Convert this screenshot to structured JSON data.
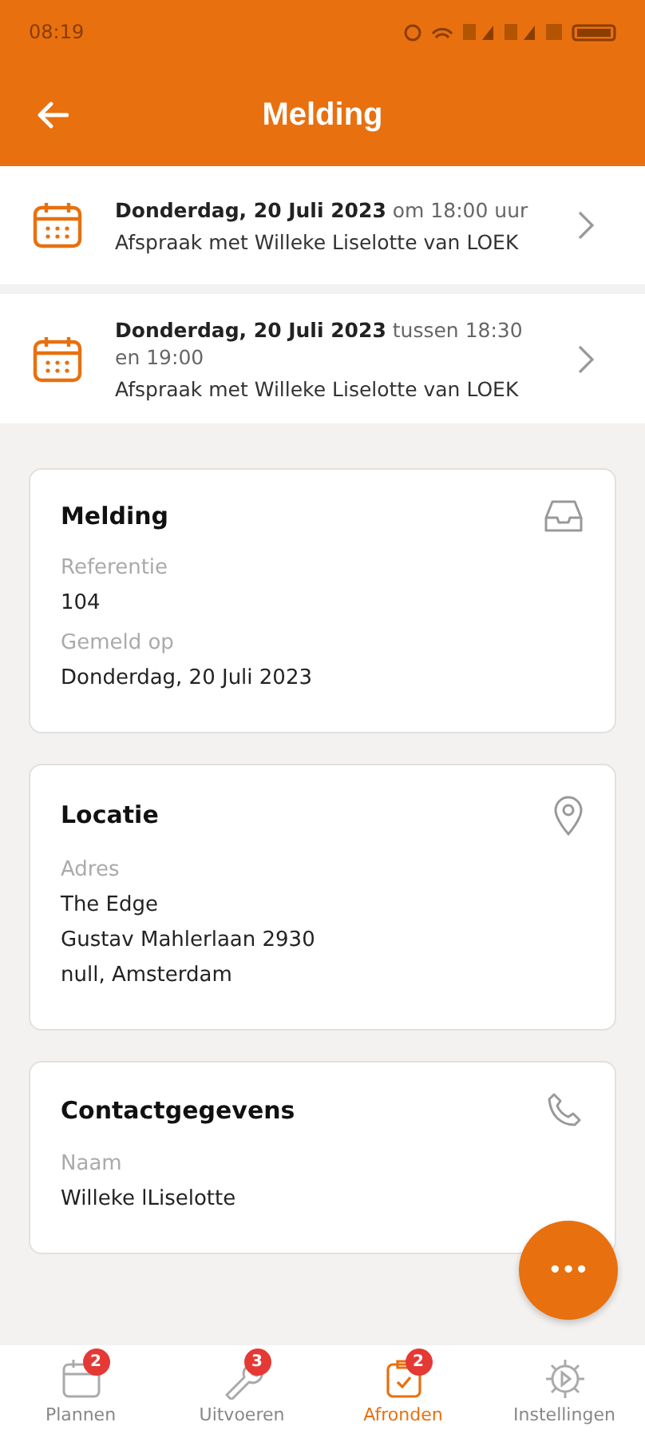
{
  "status_bar": {
    "time": "08:19"
  },
  "header": {
    "title": "Melding"
  },
  "appointments": [
    {
      "when": "**Donderdag, 20 Juli 2023** om 18:00 uur",
      "subject": "Afspraak met Willeke Liselotte van LOEK"
    },
    {
      "when": "**Donderdag, 20 Juli 2023** tussen 18:30 en 19:00",
      "subject": "Afspraak met Willeke Liselotte van LOEK"
    }
  ],
  "cards": [
    {
      "title": "Melding",
      "kind": "inbox",
      "fields": [
        {
          "label": "Referentie",
          "lines": [
            "104"
          ]
        },
        {
          "label": "Gemeld op",
          "lines": [
            "Donderdag, 20 Juli 2023"
          ]
        }
      ]
    },
    {
      "title": "Locatie",
      "kind": "pin",
      "fields": [
        {
          "label": "Adres",
          "lines": [
            "The Edge",
            "Gustav Mahlerlaan 2930",
            "null, Amsterdam"
          ]
        }
      ]
    },
    {
      "title": "Contactgegevens",
      "kind": "phone",
      "fields": [
        {
          "label": "Naam",
          "lines": [
            "Willeke lLiselotte"
          ]
        }
      ]
    }
  ],
  "fab": {
    "label": "•••"
  },
  "nav": [
    {
      "label": "Plannen",
      "kind": "calendar",
      "badge": "2",
      "selected": false
    },
    {
      "label": "Uitvoeren",
      "kind": "wrench",
      "badge": "3",
      "selected": false
    },
    {
      "label": "Afronden",
      "kind": "clipboard",
      "badge": "2",
      "selected": true
    },
    {
      "label": "Instellingen",
      "kind": "gear",
      "selected": false
    }
  ]
}
